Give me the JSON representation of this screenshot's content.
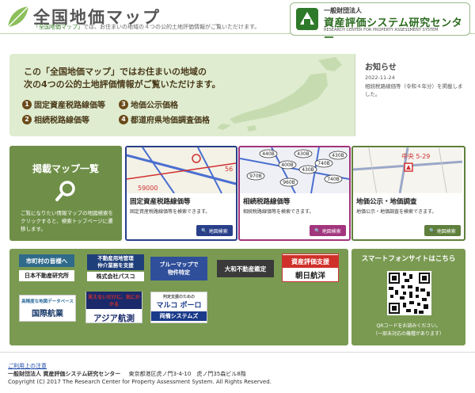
{
  "header": {
    "title": "全国地価マップ",
    "subtitle_quote": "「全国地価マップ」",
    "subtitle_rest": "では、お住まいの地域の４つの公的土地評価情報がご覧いただけます。",
    "org_small": "一般財団法人",
    "org_main": "資産評価システム研究センター",
    "org_eng": "RESEARCH CENTER FOR PROPERTY ASSESSMENT SYSTEM"
  },
  "banner": {
    "line1": "この「全国地価マップ」ではお住まいの地域の",
    "line2": "次の4つの公的土地評価情報がご覧いただけます。",
    "items": [
      {
        "num": "1",
        "label": "固定資産税路線価等"
      },
      {
        "num": "2",
        "label": "相続税路線価等"
      },
      {
        "num": "3",
        "label": "地価公示価格"
      },
      {
        "num": "4",
        "label": "都道府県地価調査価格"
      }
    ]
  },
  "news": {
    "title": "お知らせ",
    "date": "2022-11-24",
    "text": "相続税路線価等（令和４年分）を掲載しました。"
  },
  "map_list": {
    "title": "掲載マップ一覧",
    "desc": "ご覧になりたい情報マップの地図検索をクリックすると、検索トップページに遷移します。"
  },
  "cards": [
    {
      "title": "固定資産税路線価等",
      "desc": "固定資産税路線価等を検索できます。",
      "button": "地図検索",
      "color": "#283f8a"
    },
    {
      "title": "相続税路線価等",
      "desc": "相続税路線価等を検索できます。",
      "button": "地図検索",
      "color": "#a2357d"
    },
    {
      "title": "地価公示・地価調査",
      "desc": "地価公示・地価調査を検索できます。",
      "button": "地図検索",
      "color": "#5f7f3c"
    }
  ],
  "card_thumb_labels": {
    "c1": [
      "59000",
      "56"
    ],
    "c2": [
      "440B",
      "430B",
      "400B",
      "970B",
      "430B",
      "740B",
      "960B",
      "740B",
      "430B"
    ],
    "c3": [
      "中央 5-29"
    ]
  },
  "links": {
    "l1_top": "市町村の皆様へ",
    "l1_bottom": "日本不動産研究所",
    "l2_top1": "不動産用地管理",
    "l2_top2": "仲介業務を支援",
    "l2_bottom": "株式会社パスコ",
    "l3_line1": "ブルーマップで",
    "l3_line2": "物件特定",
    "l4": "大和不動産鑑定",
    "l5_top": "資産評価支援",
    "l5_bottom": "朝日航洋",
    "l6_top": "高精度な地図データベース",
    "l6_bottom": "国際航業",
    "l7_top": "見えないだけに、気にかかる",
    "l7_bottom": "アジア航測",
    "l8_top": "マルコ ポーロ",
    "l8_small": "判定支援のための",
    "l8_bottom": "両備システムズ"
  },
  "phone": {
    "title": "スマートフォンサイトはこちら",
    "note1": "QRコードをお読みください。",
    "note2": "（一部未対応の機種があります）"
  },
  "footer": {
    "note": "ご利用上の注意",
    "org": "一般財団法人 資産評価システム研究センター",
    "address": "東京都港区虎ノ門3-4-10　虎ノ門35森ビル8階",
    "copyright": "Copyright (C) 2017 The Research Center for Property Assessment System. All Rights Reserved."
  },
  "colors": {
    "accent_green": "#6f8f48",
    "card1": "#283f8a",
    "card2": "#a2357d",
    "card3": "#5f7f3c"
  }
}
